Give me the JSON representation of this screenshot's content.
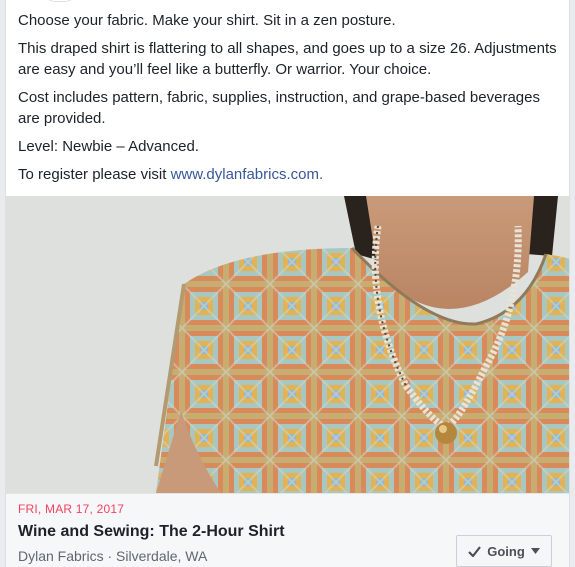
{
  "post": {
    "paragraphs": [
      "Choose your fabric. Make your shirt. Sit in a zen posture.",
      "This draped shirt is flattering to all shapes, and goes up to a size 26. Adjustments are easy and you’ll feel like a butterfly. Or warrior. Your choice.",
      "Cost includes pattern, fabric, supplies, instruction, and grape-based beverages are provided.",
      "Level: Newbie – Advanced."
    ],
    "register_prefix": "To register please visit ",
    "register_link": "www.dylanfabrics.com."
  },
  "event": {
    "date": "FRI, MAR 17, 2017",
    "title": "Wine and Sewing: The 2-Hour Shirt",
    "meta": "Dylan Fabrics · Silverdale, WA",
    "going_label": "Going"
  },
  "colors": {
    "link": "#365899",
    "date_accent": "#f3425f"
  },
  "icons": {
    "going_check": "check-icon",
    "going_caret": "caret-down-icon"
  }
}
